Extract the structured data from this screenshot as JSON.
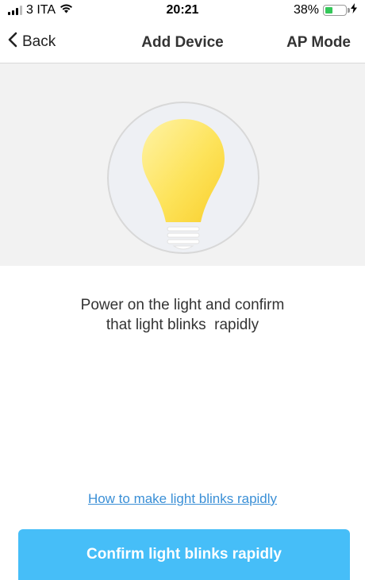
{
  "status_bar": {
    "carrier": "3 ITA",
    "time": "20:21",
    "battery_percent": "38%",
    "battery_level": 0.38,
    "wifi_icon": "wifi-icon",
    "charging_icon": "bolt-icon"
  },
  "nav": {
    "back_label": "Back",
    "title": "Add Device",
    "right_label": "AP Mode"
  },
  "hero": {
    "icon": "light-bulb-icon"
  },
  "instruction": {
    "line1": "Power on the light and confirm",
    "line2": "that light blinks  rapidly"
  },
  "help_link": "How to make light blinks rapidly",
  "confirm_button": "Confirm light blinks rapidly",
  "colors": {
    "accent": "#46bef8",
    "link": "#3a8fd6",
    "bulb": "#fde35a",
    "battery": "#34c759"
  }
}
